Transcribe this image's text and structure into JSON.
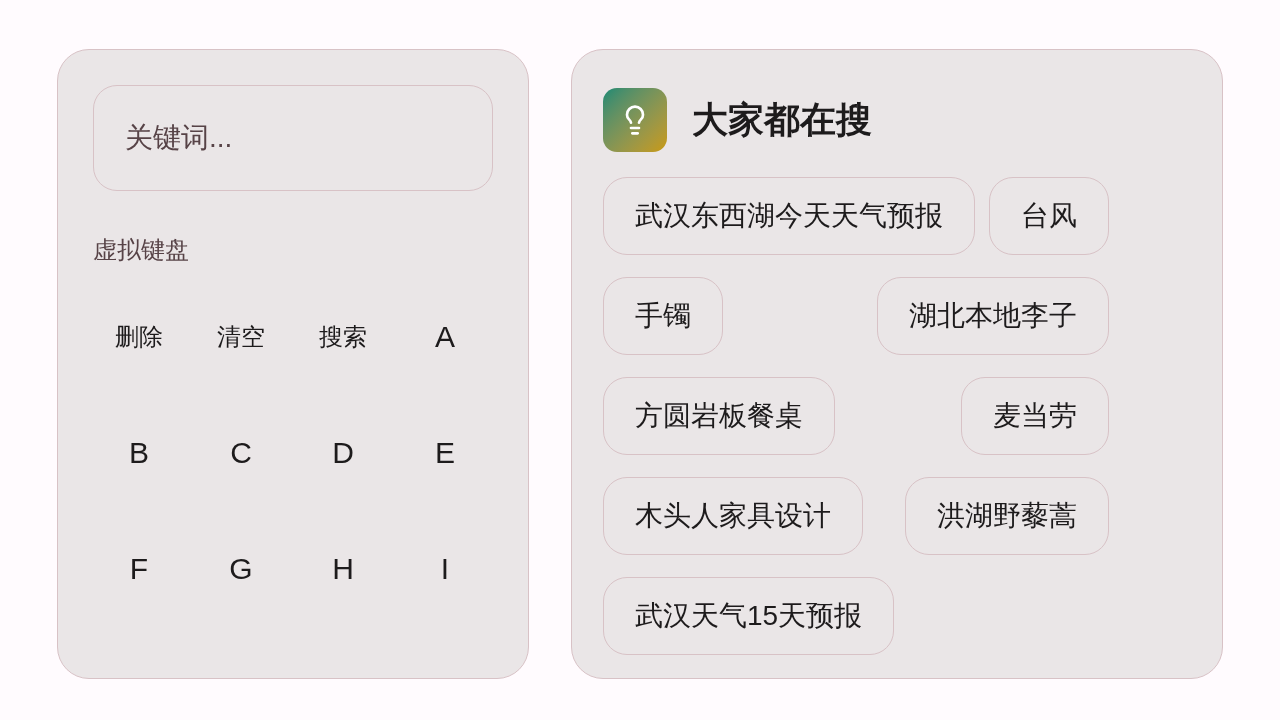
{
  "search_panel": {
    "search_field": {
      "placeholder": "关键词..."
    },
    "keyboard": {
      "title": "虚拟键盘",
      "keys": [
        {
          "label": "删除",
          "kind": "action"
        },
        {
          "label": "清空",
          "kind": "action"
        },
        {
          "label": "搜索",
          "kind": "action"
        },
        {
          "label": "A",
          "kind": "letter"
        },
        {
          "label": "B",
          "kind": "letter"
        },
        {
          "label": "C",
          "kind": "letter"
        },
        {
          "label": "D",
          "kind": "letter"
        },
        {
          "label": "E",
          "kind": "letter"
        },
        {
          "label": "F",
          "kind": "letter"
        },
        {
          "label": "G",
          "kind": "letter"
        },
        {
          "label": "H",
          "kind": "letter"
        },
        {
          "label": "I",
          "kind": "letter"
        }
      ]
    }
  },
  "trending_panel": {
    "title": "大家都在搜",
    "suggestions": [
      "武汉东西湖今天天气预报",
      "台风",
      "手镯",
      "湖北本地李子",
      "方圆岩板餐桌",
      "麦当劳",
      "木头人家具设计",
      "洪湖野藜蒿",
      "武汉天气15天预报"
    ]
  }
}
